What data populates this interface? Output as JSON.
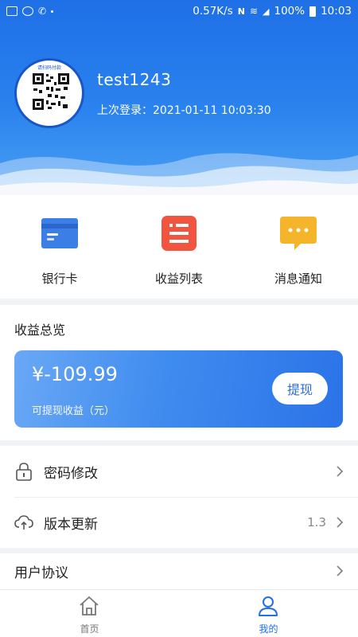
{
  "status_bar": {
    "network_speed": "0.57K/s",
    "battery": "100%",
    "time": "10:03",
    "icons": [
      "image-icon",
      "messenger-icon",
      "phone-icon",
      "nfc-icon",
      "wifi-icon",
      "signal-icon",
      "battery-icon"
    ]
  },
  "profile": {
    "qr_caption": "请扫码付款",
    "username": "test1243",
    "last_login": "上次登录：2021-01-11 10:03:30"
  },
  "quick_actions": [
    {
      "label": "银行卡",
      "icon": "bank-card-icon"
    },
    {
      "label": "收益列表",
      "icon": "earnings-list-icon"
    },
    {
      "label": "消息通知",
      "icon": "message-notification-icon"
    }
  ],
  "earnings": {
    "title": "收益总览",
    "amount": "¥-109.99",
    "subtitle": "可提现收益（元）",
    "withdraw_label": "提现"
  },
  "settings": [
    {
      "label": "密码修改",
      "icon": "lock-icon",
      "value": ""
    },
    {
      "label": "版本更新",
      "icon": "cloud-upload-icon",
      "value": "1.3"
    }
  ],
  "settings2": [
    {
      "label": "用户协议"
    }
  ],
  "tabbar": [
    {
      "label": "首页",
      "icon": "home-icon"
    },
    {
      "label": "我的",
      "icon": "user-icon"
    }
  ],
  "colors": {
    "primary": "#1f6fe6",
    "card_blue": "#3f8cef",
    "bank_icon": "#3b7ee6",
    "list_icon": "#f1543f",
    "message_icon": "#f5b52a"
  }
}
